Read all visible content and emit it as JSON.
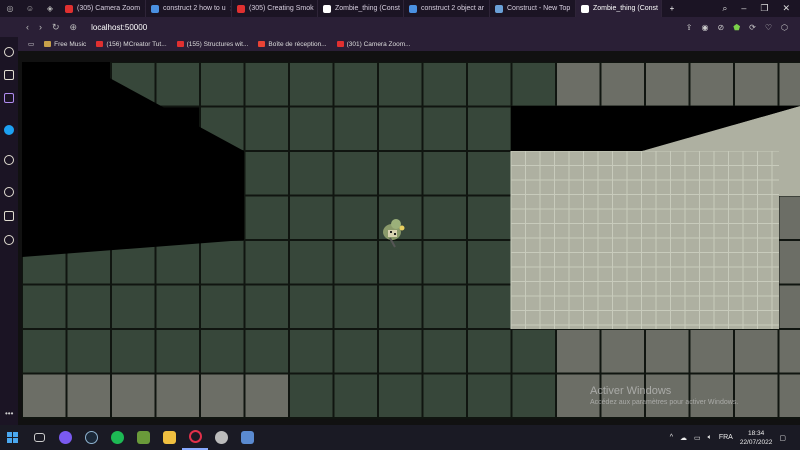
{
  "browser": {
    "tabs": [
      {
        "label": "(305) Camera Zoom",
        "color": "#e03030"
      },
      {
        "label": "construct 2 how to u",
        "color": "#4a90e2"
      },
      {
        "label": "(305) Creating Smok",
        "color": "#e03030"
      },
      {
        "label": "Zombie_thing (Const",
        "color": "#ffffff"
      },
      {
        "label": "construct 2 object ar",
        "color": "#4a90e2"
      },
      {
        "label": "Construct - New Top",
        "color": "#6aa0d8"
      },
      {
        "label": "Zombie_thing (Const",
        "color": "#ffffff",
        "active": true
      }
    ],
    "url": "localhost:50000",
    "bookmarks": [
      {
        "label": "Free Music",
        "color": "#c8a04a"
      },
      {
        "label": "(156) MCreator Tut...",
        "color": "#e03030"
      },
      {
        "label": "(155) Structures wit...",
        "color": "#e03030"
      },
      {
        "label": "Boîte de réception...",
        "color": "#ea4335"
      },
      {
        "label": "(301) Camera Zoom...",
        "color": "#e03030"
      }
    ]
  },
  "game": {
    "tile_colors": {
      "dark": "#37473a",
      "grey": "#6c6e66",
      "light": "#aeb0a1",
      "light_grid": "#c8cbbc",
      "void": "#000000",
      "grid": "#101510"
    },
    "tile_map": [
      "XXXXXXXXXXXXXXXXXX",
      "XXXXXXXXXXXXXXXXXX",
      "XXXXXXXXXXXXXXXXXX",
      "XXXXXXXXXXXXXXXXXX",
      "XXXXXXXXXXXXXXXXXX",
      "XXXXXXXXXXXXXXXXXX",
      "XXXXXXXXXXXXXXXXXX",
      "XXXXXXXXXXXXXXXXXX"
    ],
    "watermark": {
      "title": "Activer Windows",
      "subtitle": "Accédez aux paramètres pour activer Windows."
    }
  },
  "taskbar": {
    "lang": "FRA",
    "time": "18:34",
    "date": "22/07/2022"
  }
}
